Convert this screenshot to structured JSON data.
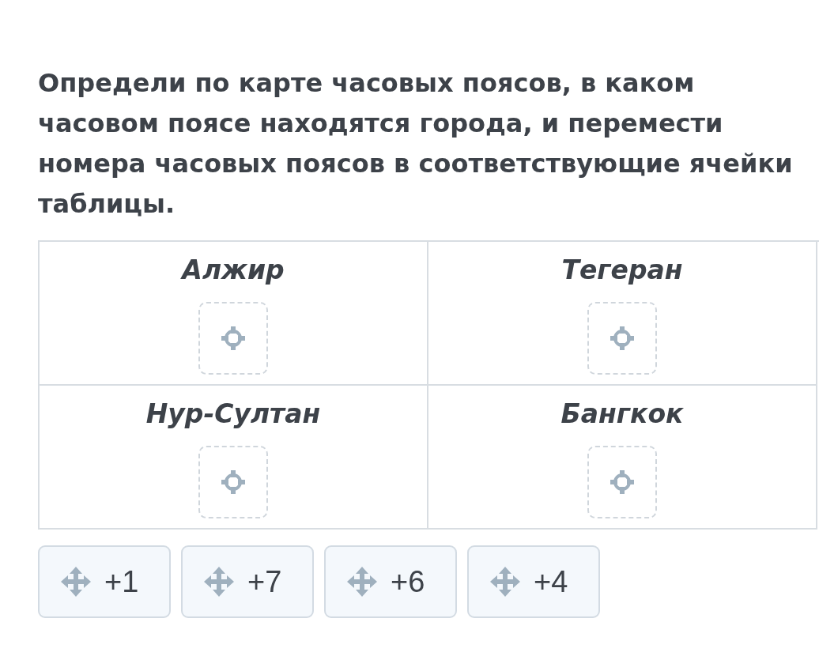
{
  "question": "Определи по карте часовых поясов, в каком часовом поясе находятся города, и перемести номера часовых поясов в соответствующие ячейки таблицы.",
  "table": {
    "cells": [
      {
        "city": "Алжир"
      },
      {
        "city": "Тегеран"
      },
      {
        "city": "Нур-Султан"
      },
      {
        "city": "Бангкок"
      }
    ]
  },
  "answers": [
    {
      "label": "+1"
    },
    {
      "label": "+7"
    },
    {
      "label": "+6"
    },
    {
      "label": "+4"
    }
  ]
}
